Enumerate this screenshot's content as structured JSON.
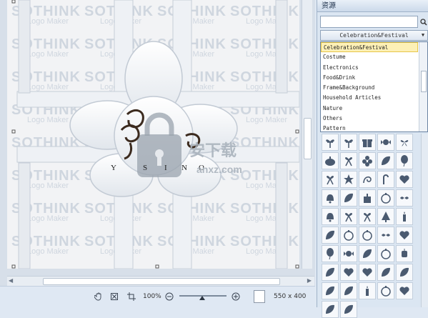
{
  "canvas": {
    "watermark_big": "SOTHINK",
    "watermark_small": "Logo Maker",
    "logo_letters": [
      "Y",
      "S",
      "I",
      "N",
      "O"
    ]
  },
  "statusbar": {
    "zoom_label": "100%",
    "canvas_size": "550 x 400",
    "icons": [
      "hand-icon",
      "fit-icon",
      "crop-icon",
      "zoom-out-icon",
      "zoom-in-icon"
    ]
  },
  "panel": {
    "title": "资源",
    "search": {
      "value": ""
    },
    "category_selected": "Celebration&Festival",
    "categories": [
      "Celebration&Festival",
      "Costume",
      "Electronics",
      "Food&Drink",
      "Frame&Background",
      "Household Articles",
      "Nature",
      "Others",
      "Pattern"
    ],
    "selected_index": 0,
    "shapes": [
      "gift-bow",
      "gift-bow",
      "gift-box",
      "candy",
      "butterfly",
      "pumpkin",
      "ribbon",
      "flower",
      "leaf",
      "balloon",
      "ribbon",
      "star",
      "swirl",
      "candy-cane",
      "heart",
      "bell",
      "leaf",
      "gift",
      "ornament",
      "holly",
      "bell",
      "ribbon",
      "ribbon",
      "tree",
      "candle",
      "leaf",
      "ornament",
      "ornament",
      "holly",
      "heart",
      "balloon",
      "candy",
      "leaf",
      "ornament",
      "lantern",
      "leaf",
      "heart",
      "heart",
      "leaf",
      "leaf",
      "leaf",
      "leaf",
      "candle",
      "ornament",
      "heart",
      "leaf",
      "leaf"
    ],
    "colors": {
      "accent": "#fdf0b6",
      "shape": "#4a5a70"
    }
  }
}
